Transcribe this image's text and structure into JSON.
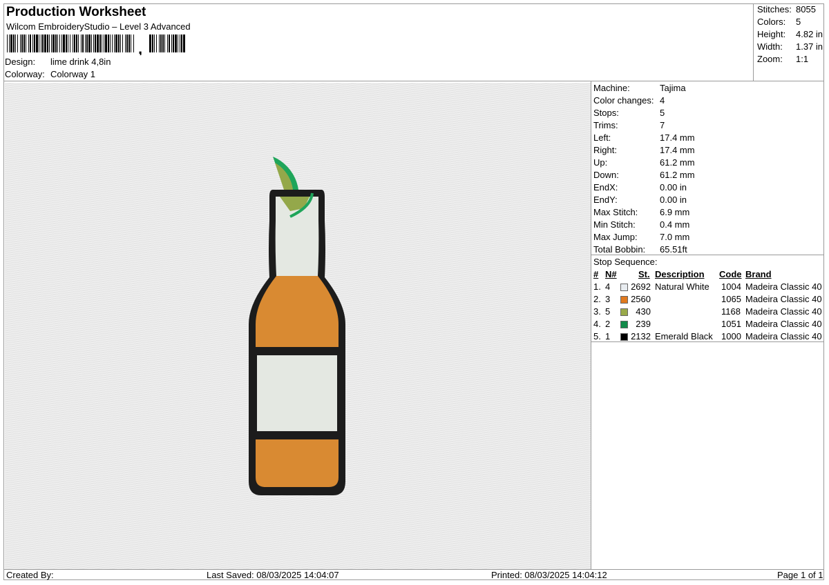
{
  "header": {
    "title": "Production Worksheet",
    "software": "Wilcom EmbroideryStudio – Level 3 Advanced",
    "barcode_char": ",",
    "design_label": "Design:",
    "design_value": "lime drink 4,8in",
    "colorway_label": "Colorway:",
    "colorway_value": "Colorway 1"
  },
  "summary": {
    "stitches_label": "Stitches:",
    "stitches_value": "8055",
    "colors_label": "Colors:",
    "colors_value": "5",
    "height_label": "Height:",
    "height_value": "4.82 in",
    "width_label": "Width:",
    "width_value": "1.37 in",
    "zoom_label": "Zoom:",
    "zoom_value": "1:1"
  },
  "machine_info": [
    {
      "label": "Machine:",
      "value": "Tajima"
    },
    {
      "label": "Color changes:",
      "value": "4"
    },
    {
      "label": "Stops:",
      "value": "5"
    },
    {
      "label": "Trims:",
      "value": "7"
    },
    {
      "label": "Left:",
      "value": "17.4 mm"
    },
    {
      "label": "Right:",
      "value": "17.4 mm"
    },
    {
      "label": "Up:",
      "value": "61.2 mm"
    },
    {
      "label": "Down:",
      "value": "61.2 mm"
    },
    {
      "label": "EndX:",
      "value": "0.00 in"
    },
    {
      "label": "EndY:",
      "value": "0.00 in"
    },
    {
      "label": "Max Stitch:",
      "value": "6.9 mm"
    },
    {
      "label": "Min Stitch:",
      "value": "0.4 mm"
    },
    {
      "label": "Max Jump:",
      "value": "7.0 mm"
    },
    {
      "label": "Total Bobbin:",
      "value": "65.51ft"
    }
  ],
  "stop_sequence": {
    "title": "Stop Sequence:",
    "columns": {
      "num": "#",
      "n": "N#",
      "st": "St.",
      "description": "Description",
      "code": "Code",
      "brand": "Brand"
    },
    "rows": [
      {
        "num": "1.",
        "n": "4",
        "st": "2692",
        "color": "#e8ecf0",
        "description": "Natural White",
        "code": "1004",
        "brand": "Madeira Classic 40"
      },
      {
        "num": "2.",
        "n": "3",
        "st": "2560",
        "color": "#e07a1f",
        "description": "",
        "code": "1065",
        "brand": "Madeira Classic 40"
      },
      {
        "num": "3.",
        "n": "5",
        "st": "430",
        "color": "#9aaa4a",
        "description": "",
        "code": "1168",
        "brand": "Madeira Classic 40"
      },
      {
        "num": "4.",
        "n": "2",
        "st": "239",
        "color": "#128a4a",
        "description": "",
        "code": "1051",
        "brand": "Madeira Classic 40"
      },
      {
        "num": "5.",
        "n": "1",
        "st": "2132",
        "color": "#000000",
        "description": "Emerald Black",
        "code": "1000",
        "brand": "Madeira Classic 40"
      }
    ]
  },
  "design_colors": {
    "outline": "#1c1c1c",
    "glass_light": "#e4e8e2",
    "amber": "#d98a32",
    "lime_flesh": "#94a84a",
    "lime_rind": "#1fa55a"
  },
  "footer": {
    "created_by": "Created By:",
    "last_saved": "Last Saved: 08/03/2025 14:04:07",
    "printed": "Printed: 08/03/2025 14:04:12",
    "page": "Page 1 of 1"
  }
}
